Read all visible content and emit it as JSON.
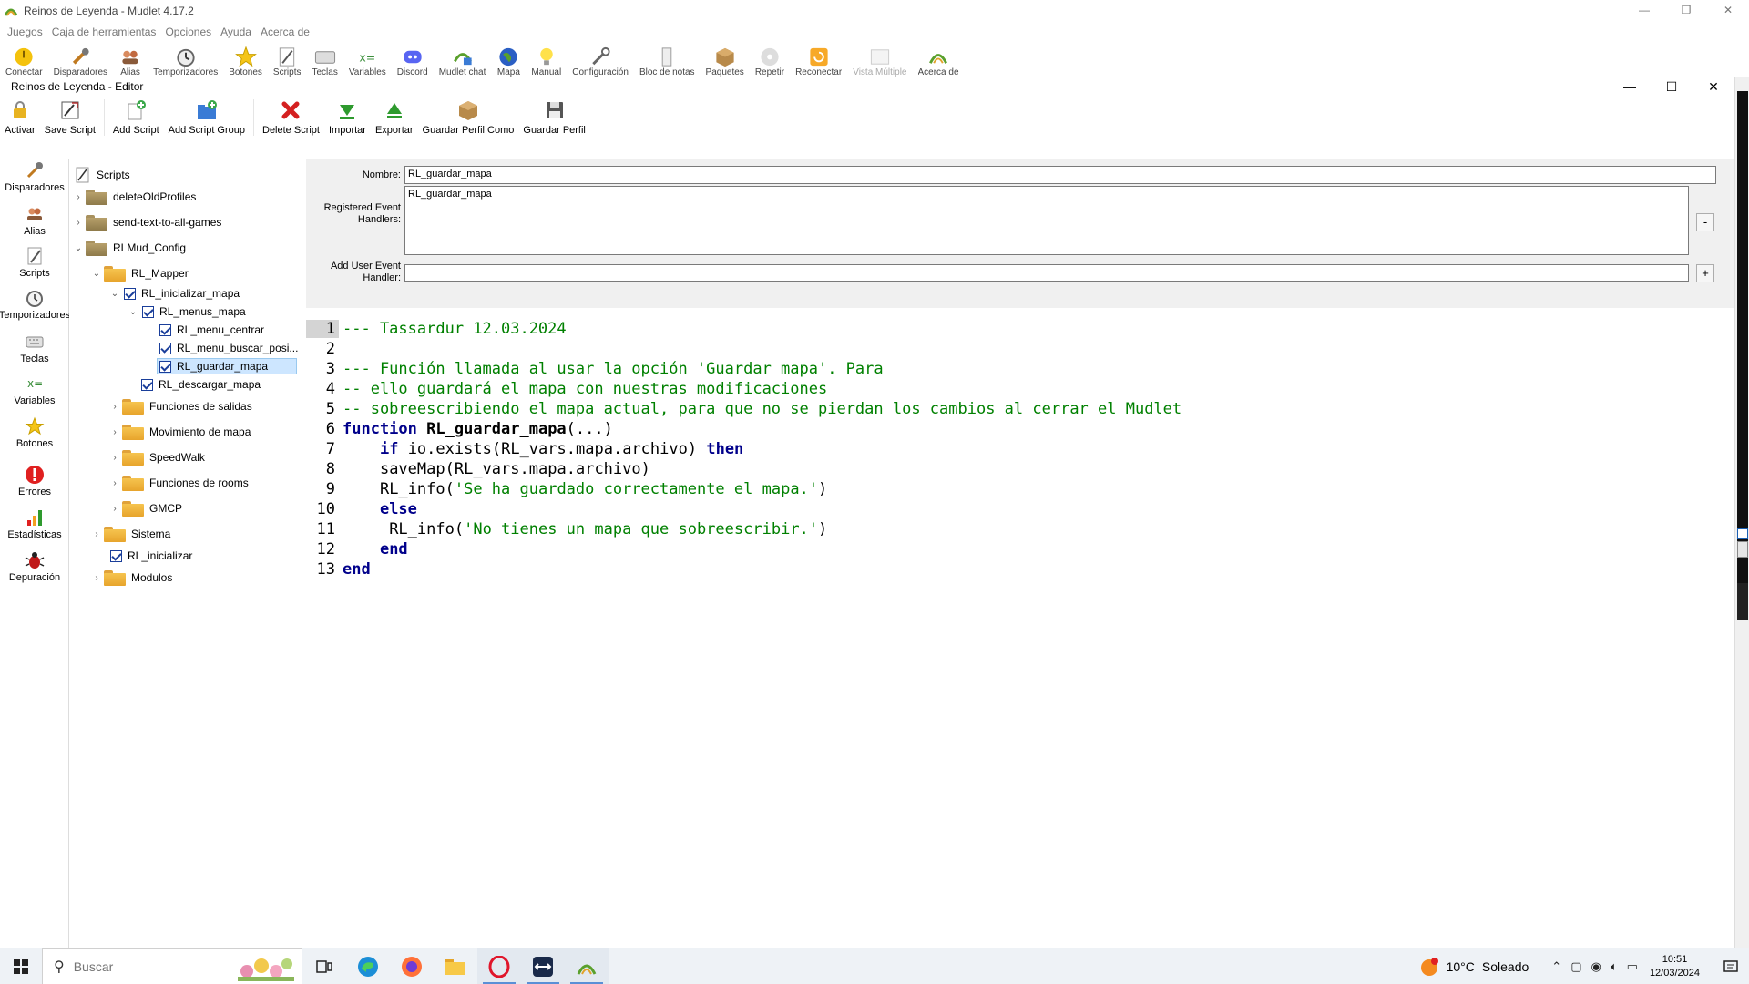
{
  "main_window": {
    "title": "Reinos de Leyenda - Mudlet 4.17.2",
    "menu": [
      "Juegos",
      "Caja de herramientas",
      "Opciones",
      "Ayuda",
      "Acerca de"
    ],
    "toolbar": [
      "Conectar",
      "Disparadores",
      "Alias",
      "Temporizadores",
      "Botones",
      "Scripts",
      "Teclas",
      "Variables",
      "Discord",
      "Mudlet chat",
      "Mapa",
      "Manual",
      "Configuración",
      "Bloc de notas",
      "Paquetes",
      "Repetir",
      "Reconectar",
      "Vista Múltiple",
      "Acerca de"
    ]
  },
  "editor": {
    "title": "Reinos de Leyenda - Editor",
    "toolbar": {
      "activate": "Activar",
      "save_script": "Save Script",
      "add_script": "Add Script",
      "add_script_group": "Add Script Group",
      "delete_script": "Delete Script",
      "import": "Importar",
      "export": "Exportar",
      "save_profile_as": "Guardar Perfil Como",
      "save_profile": "Guardar Perfil"
    },
    "categories": {
      "triggers": "Disparadores",
      "aliases": "Alias",
      "scripts": "Scripts",
      "timers": "Temporizadores",
      "keys": "Teclas",
      "variables": "Variables",
      "buttons": "Botones",
      "errors": "Errores",
      "statistics": "Estadísticas",
      "debug": "Depuración"
    },
    "tree": {
      "root": "Scripts",
      "n1": "deleteOldProfiles",
      "n2": "send-text-to-all-games",
      "n3": "RLMud_Config",
      "n4": "RL_Mapper",
      "n5": "RL_inicializar_mapa",
      "n6": "RL_menus_mapa",
      "n7": "RL_menu_centrar",
      "n8": "RL_menu_buscar_posi...",
      "n9": "RL_guardar_mapa",
      "n10": "RL_descargar_mapa",
      "n11": "Funciones de salidas",
      "n12": "Movimiento de mapa",
      "n13": "SpeedWalk",
      "n14": "Funciones de rooms",
      "n15": "GMCP",
      "n16": "Sistema",
      "n17": "RL_inicializar",
      "n18": "Modulos"
    },
    "form": {
      "name_label": "Nombre:",
      "name_value": "RL_guardar_mapa",
      "handlers_label": "Registered Event Handlers:",
      "handlers_value": "RL_guardar_mapa",
      "remove_btn": "-",
      "add_handler_label": "Add User Event Handler:",
      "add_handler_value": "",
      "add_btn": "+"
    },
    "code": {
      "current_line": 1,
      "lines": [
        "--- Tassardur 12.03.2024",
        "",
        "--- Función llamada al usar la opción 'Guardar mapa'. Para",
        "-- ello guardará el mapa con nuestras modificaciones",
        "-- sobreescribiendo el mapa actual, para que no se pierdan los cambios al cerrar el Mudlet",
        "function RL_guardar_mapa(...)",
        "    if io.exists(RL_vars.mapa.archivo) then",
        "    saveMap(RL_vars.mapa.archivo)",
        "    RL_info('Se ha guardado correctamente el mapa.')",
        "    else",
        "     RL_info('No tienes un mapa que sobreescribir.')",
        "    end",
        "end"
      ]
    }
  },
  "taskbar": {
    "search_placeholder": "Buscar",
    "weather_temp": "10°C",
    "weather_desc": "Soleado",
    "time": "10:51",
    "date": "12/03/2024"
  }
}
